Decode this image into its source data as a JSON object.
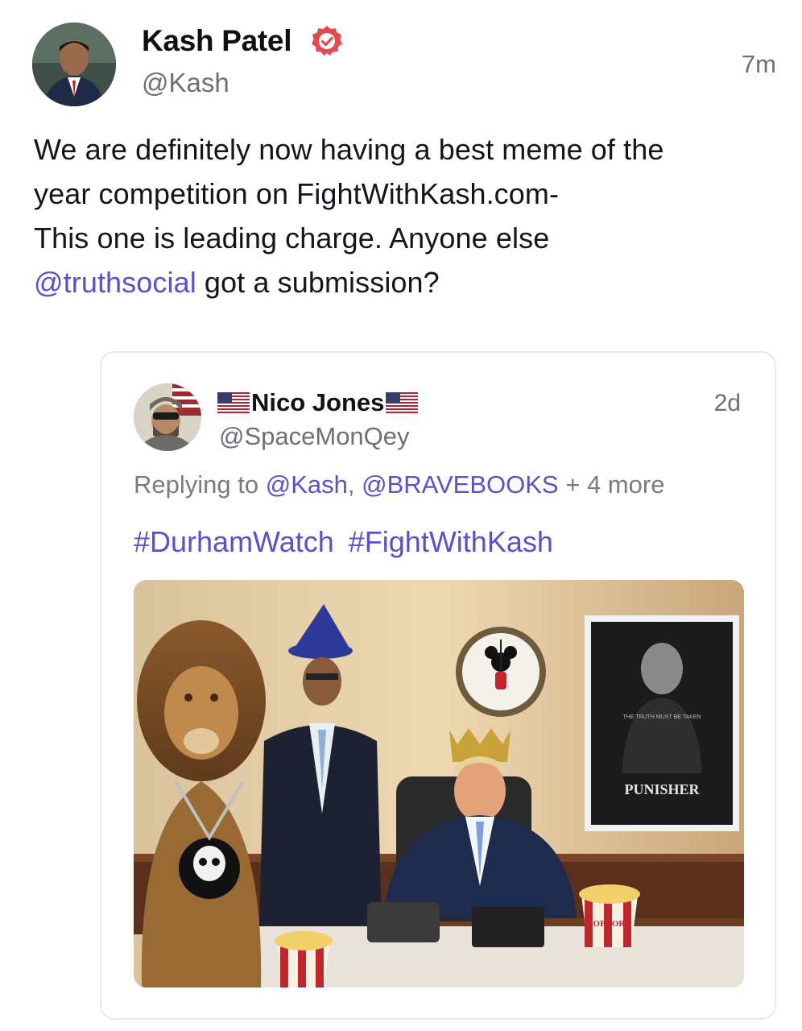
{
  "post": {
    "author_name": "Kash Patel",
    "author_handle": "@Kash",
    "timestamp": "7m",
    "verified_icon": "verified-badge-icon",
    "text_line1": "We are definitely now having a best meme of the",
    "text_line2": "year competition on FightWithKash.com-",
    "text_line3": "This one is leading charge. Anyone else",
    "text_mention": "@truthsocial",
    "text_line4_rest": " got a submission?"
  },
  "quote": {
    "author_name": "Nico Jones",
    "author_handle": "@SpaceMonQey",
    "timestamp": "2d",
    "replying_prefix": "Replying to ",
    "replying_mention1": "@Kash",
    "replying_sep": ", ",
    "replying_mention2": "@BRAVEBOOKS",
    "replying_more": " + 4 more",
    "hashtag1": "#DurhamWatch",
    "hashtag2": "#FightWithKash",
    "image": {
      "poster_title": "PUNISHER",
      "poster_tagline": "THE TRUTH MUST BE TAKEN",
      "popcorn_label": "POPCORN"
    }
  },
  "colors": {
    "accent": "#5a4fcf",
    "verified": "#e5484d",
    "secondary_text": "#6e6e78"
  }
}
